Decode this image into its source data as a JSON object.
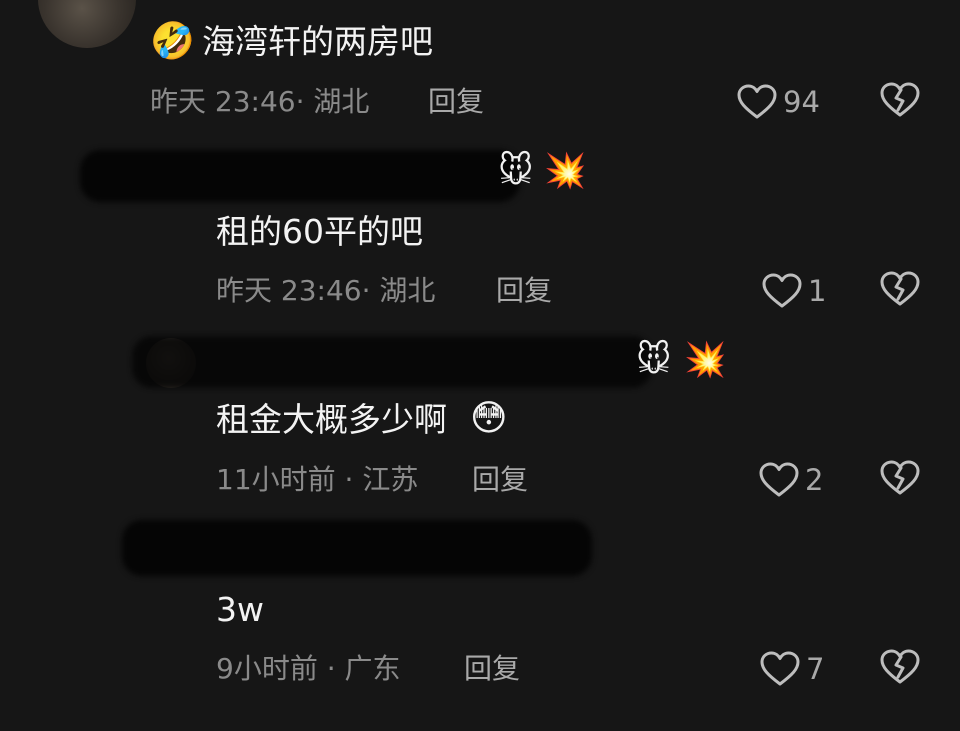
{
  "comments": [
    {
      "text": "海湾轩的两房吧",
      "time": "昨天 23:46",
      "location": "湖北",
      "reply_label": "回复",
      "likes": "94"
    },
    {
      "text": "租的60平的吧",
      "time": "昨天 23:46",
      "location": "湖北",
      "reply_label": "回复",
      "likes": "1"
    },
    {
      "text": "租金大概多少啊",
      "time": "11小时前",
      "location": "江苏",
      "reply_label": "回复",
      "likes": "2"
    },
    {
      "text": "3w",
      "time": "9小时前",
      "location": "广东",
      "reply_label": "回复",
      "likes": "7"
    }
  ],
  "emojis": {
    "laugh": "🤣",
    "mouse": "🐭",
    "burst": "💥",
    "flushed": "😳"
  }
}
